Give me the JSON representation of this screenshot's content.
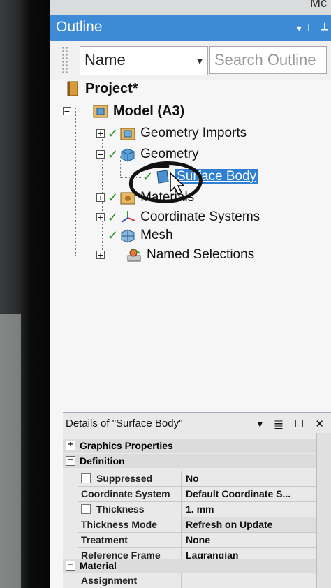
{
  "window": {
    "corner_text": "Mc"
  },
  "outline": {
    "title": "Outline",
    "pin_glyph": "▾ ⊥",
    "close_glyph": "⟂",
    "toolbar": {
      "name_label": "Name",
      "search_placeholder": "Search Outline"
    }
  },
  "tree": [
    {
      "label": "Project*",
      "icon": "project-icon",
      "expander": "",
      "check": ""
    },
    {
      "label": "Model (A3)",
      "icon": "model-icon",
      "expander": "−",
      "check": ""
    },
    {
      "label": "Geometry Imports",
      "icon": "geometry-imports-icon",
      "expander": "+",
      "check": "✓"
    },
    {
      "label": "Geometry",
      "icon": "geometry-icon",
      "expander": "−",
      "check": "✓"
    },
    {
      "label": "Surface Body",
      "icon": "surface-body-icon",
      "expander": "",
      "check": "✓"
    },
    {
      "label": "Materials",
      "icon": "materials-icon",
      "expander": "+",
      "check": "✓"
    },
    {
      "label": "Coordinate Systems",
      "icon": "coordinate-systems-icon",
      "expander": "+",
      "check": "✓"
    },
    {
      "label": "Mesh",
      "icon": "mesh-icon",
      "expander": "",
      "check": "✓"
    },
    {
      "label": "Named Selections",
      "icon": "named-selections-icon",
      "expander": "+",
      "check": ""
    }
  ],
  "details": {
    "title": "Details of \"Surface Body\"",
    "controls": "▾ ䷀ ☐ ✕",
    "sections": {
      "graphics": "Graphics Properties",
      "definition": "Definition",
      "material": "Material"
    },
    "rows": [
      {
        "key": "Suppressed",
        "value": "No"
      },
      {
        "key": "Coordinate System",
        "value": "Default Coordinate S..."
      },
      {
        "key": "Thickness",
        "value": "1. mm"
      },
      {
        "key": "Thickness Mode",
        "value": "Refresh on Update"
      },
      {
        "key": "Treatment",
        "value": "None"
      },
      {
        "key": "Reference Frame",
        "value": "Lagrangian"
      }
    ],
    "material_rows": [
      {
        "key": "Assignment",
        "value": ""
      }
    ]
  },
  "colors": {
    "header_blue": "#3d8bd6",
    "selection_blue": "#2f7fd0",
    "check_green": "#1f8a2a"
  }
}
